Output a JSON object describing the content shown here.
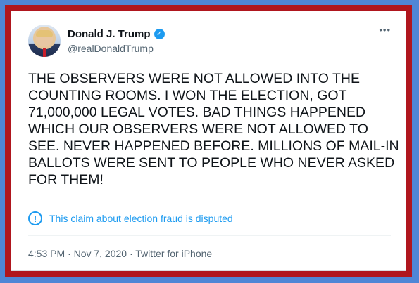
{
  "user": {
    "display_name": "Donald J. Trump",
    "handle": "@realDonaldTrump",
    "verified_icon": "✓"
  },
  "menu": {
    "more_icon": "•••"
  },
  "tweet": {
    "text": "THE OBSERVERS WERE NOT ALLOWED INTO THE COUNTING ROOMS. I WON THE ELECTION, GOT 71,000,000 LEGAL VOTES. BAD THINGS HAPPENED WHICH OUR OBSERVERS WERE NOT ALLOWED TO SEE. NEVER HAPPENED BEFORE. MILLIONS OF MAIL-IN BALLOTS WERE SENT TO PEOPLE WHO NEVER ASKED FOR THEM!"
  },
  "notice": {
    "icon": "!",
    "text": "This claim about election fraud is disputed"
  },
  "meta": {
    "text": "4:53 PM · Nov 7, 2020 · Twitter for iPhone"
  },
  "colors": {
    "background": "#4f86d6",
    "frame": "#b0161e",
    "accent": "#1d9bf0",
    "secondary_text": "#536471"
  }
}
